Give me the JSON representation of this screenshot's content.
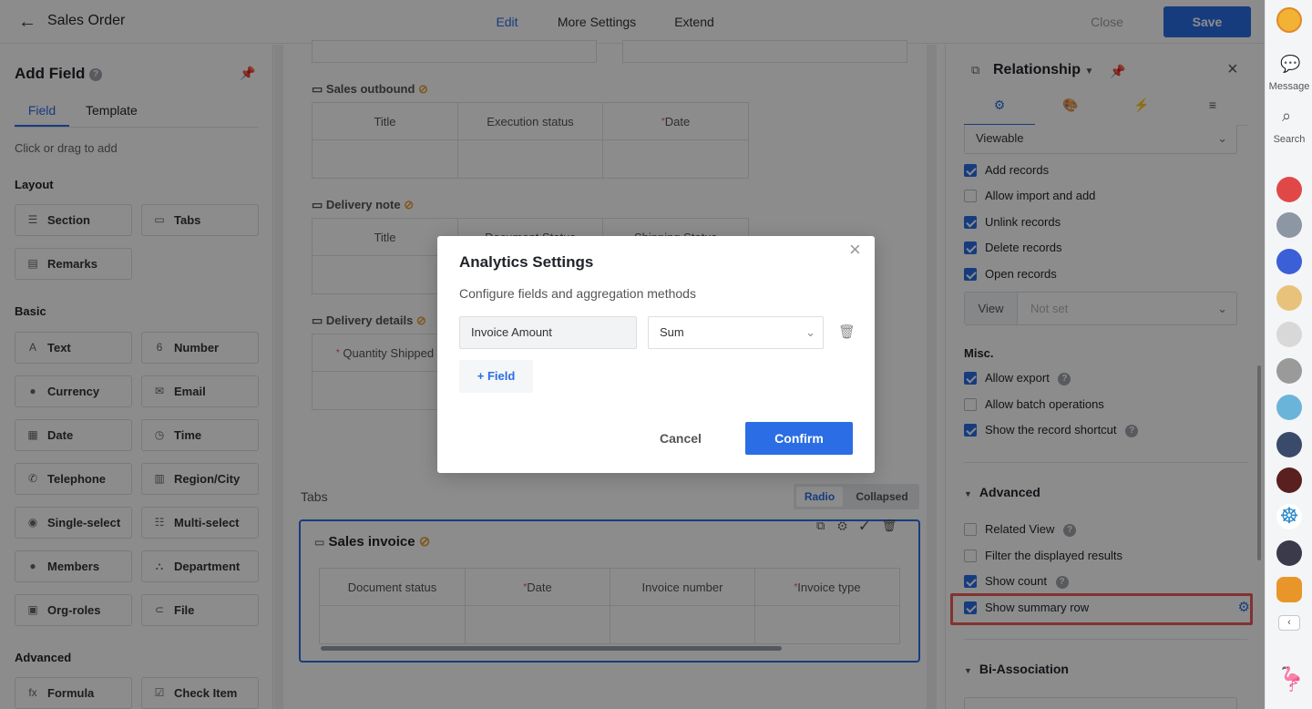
{
  "header": {
    "title": "Sales Order",
    "tabs": [
      "Edit",
      "More Settings",
      "Extend"
    ],
    "close_label": "Close",
    "save_label": "Save"
  },
  "left_panel": {
    "title": "Add Field",
    "tabs": [
      "Field",
      "Template"
    ],
    "hint": "Click or drag to add",
    "groups": {
      "layout": {
        "label": "Layout",
        "items": [
          "Section",
          "Tabs",
          "Remarks"
        ]
      },
      "basic": {
        "label": "Basic",
        "items": [
          "Text",
          "Number",
          "Currency",
          "Email",
          "Date",
          "Time",
          "Telephone",
          "Region/City",
          "Single-select",
          "Multi-select",
          "Members",
          "Department",
          "Org-roles",
          "File"
        ]
      },
      "advanced": {
        "label": "Advanced",
        "items": [
          "Formula",
          "Check Item"
        ]
      }
    }
  },
  "canvas": {
    "sections": [
      {
        "label": "Sales outbound",
        "columns": [
          "Title",
          "Execution status",
          "Date"
        ]
      },
      {
        "label": "Delivery note",
        "columns": [
          "Title",
          "Document Status",
          "Shipping Status"
        ]
      },
      {
        "label": "Delivery details",
        "columns": [
          "Quantity Shipped"
        ]
      }
    ],
    "tabs_label": "Tabs",
    "tabs_toggle": [
      "Radio",
      "Collapsed"
    ],
    "invoice": {
      "label": "Sales invoice",
      "columns": [
        "Document status",
        "Date",
        "Invoice number",
        "Invoice type"
      ]
    }
  },
  "right_panel": {
    "title": "Relationship",
    "permission_select": "Viewable",
    "record_options": [
      {
        "label": "Add records",
        "checked": true
      },
      {
        "label": "Allow import and add",
        "checked": false
      },
      {
        "label": "Unlink records",
        "checked": true
      },
      {
        "label": "Delete records",
        "checked": true
      },
      {
        "label": "Open records",
        "checked": true
      }
    ],
    "view_label": "View",
    "view_value": "Not set",
    "misc_label": "Misc.",
    "misc_options": [
      {
        "label": "Allow export",
        "checked": true
      },
      {
        "label": "Allow batch operations",
        "checked": false
      },
      {
        "label": "Show the record shortcut",
        "checked": true
      }
    ],
    "advanced_label": "Advanced",
    "advanced_options": [
      {
        "label": "Related View",
        "checked": false
      },
      {
        "label": "Filter the displayed results",
        "checked": false
      },
      {
        "label": "Show count",
        "checked": true
      },
      {
        "label": "Show summary row",
        "checked": true
      }
    ],
    "bi_label": "Bi-Association"
  },
  "sidebar": {
    "message_label": "Message",
    "search_label": "Search"
  },
  "modal": {
    "title": "Analytics Settings",
    "subtitle": "Configure fields and aggregation methods",
    "field_value": "Invoice Amount",
    "aggregation": "Sum",
    "add_field_label": "Field",
    "cancel_label": "Cancel",
    "confirm_label": "Confirm"
  },
  "colors": {
    "accent": "#2b6de5",
    "highlight": "#f05a5a"
  }
}
